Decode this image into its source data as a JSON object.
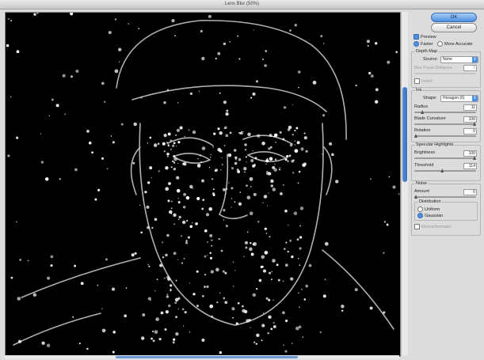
{
  "window": {
    "title": "Lens Blur (50%)"
  },
  "buttons": {
    "ok": "OK",
    "cancel": "Cancel"
  },
  "preview_options": {
    "preview": "Preview",
    "faster": "Faster",
    "more_accurate": "More Accurate"
  },
  "depth_map": {
    "heading": "Depth Map",
    "source_label": "Source:",
    "source_value": "None",
    "blur_focal_distance_label": "Blur Focal Distance",
    "blur_focal_distance_value": "0",
    "invert": "Invert"
  },
  "iris": {
    "heading": "Iris",
    "shape_label": "Shape:",
    "shape_value": "Hexagon (6)",
    "radius_label": "Radius",
    "radius_value": "11",
    "radius_fraction": 0.11,
    "blade_curvature_label": "Blade Curvature",
    "blade_curvature_value": "100",
    "blade_curvature_fraction": 1.0,
    "rotation_label": "Rotation",
    "rotation_value": "0",
    "rotation_fraction": 0.0
  },
  "specular": {
    "heading": "Specular Highlights",
    "brightness_label": "Brightness",
    "brightness_value": "100",
    "brightness_fraction": 1.0,
    "threshold_label": "Threshold",
    "threshold_value": "114",
    "threshold_fraction": 0.45
  },
  "noise": {
    "heading": "Noise",
    "amount_label": "Amount",
    "amount_value": "0",
    "amount_fraction": 0.0,
    "distribution_heading": "Distribution",
    "uniform": "Uniform",
    "gaussian": "Gaussian",
    "monochromatic": "Monochromatic"
  },
  "colors": {
    "accent": "#4f8fe0",
    "preview_bg": "#000000",
    "highlight": "#ffffff"
  }
}
